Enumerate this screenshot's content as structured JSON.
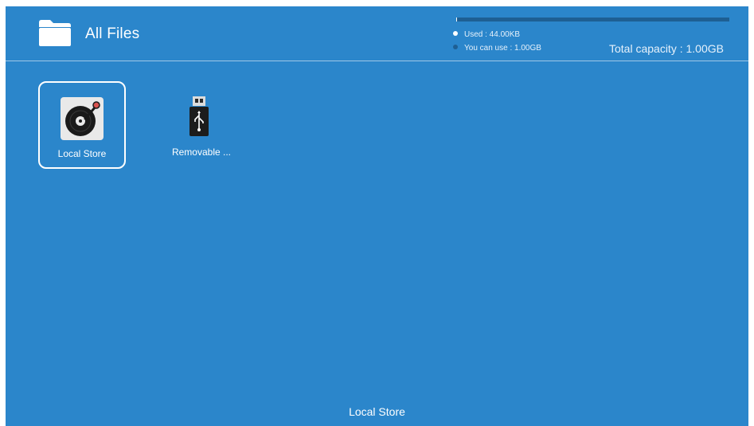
{
  "header": {
    "title": "All Files",
    "icon": "folder-icon"
  },
  "storage": {
    "used_label": "Used : 44.00KB",
    "free_label": "You can use : 1.00GB",
    "total_label": "Total capacity : 1.00GB",
    "used_fraction": 4e-05,
    "used_color": "#ffffff",
    "free_color": "#1e5f93"
  },
  "devices": [
    {
      "label": "Local Store",
      "icon": "turntable-disk-icon",
      "selected": true
    },
    {
      "label": "Removable ...",
      "icon": "usb-drive-icon",
      "selected": false
    }
  ],
  "status": {
    "focused_label": "Local Store"
  },
  "colors": {
    "background": "#2b86cb",
    "accent": "#ffffff"
  }
}
